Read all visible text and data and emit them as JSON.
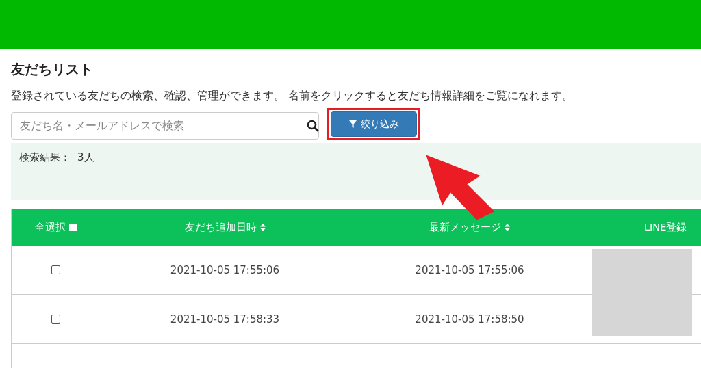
{
  "page": {
    "title": "友だちリスト",
    "description": "登録されている友だちの検索、確認、管理ができます。 名前をクリックすると友だち情報詳細をご覧になれます。"
  },
  "search": {
    "placeholder": "友だち名・メールアドレスで検索"
  },
  "filter_button": {
    "label": "絞り込み"
  },
  "result": {
    "label": "検索結果：",
    "count": "3人"
  },
  "table": {
    "select_all": {
      "label": "全選択",
      "checked": false
    },
    "columns": [
      {
        "label": "友だち追加日時",
        "sortable": true
      },
      {
        "label": "最新メッセージ",
        "sortable": true
      },
      {
        "label": "LINE登録"
      }
    ],
    "rows": [
      {
        "checked": false,
        "added": "2021-10-05 17:55:06",
        "latest": "2021-10-05 17:55:06"
      },
      {
        "checked": false,
        "added": "2021-10-05 17:58:33",
        "latest": "2021-10-05 17:58:50"
      }
    ]
  }
}
